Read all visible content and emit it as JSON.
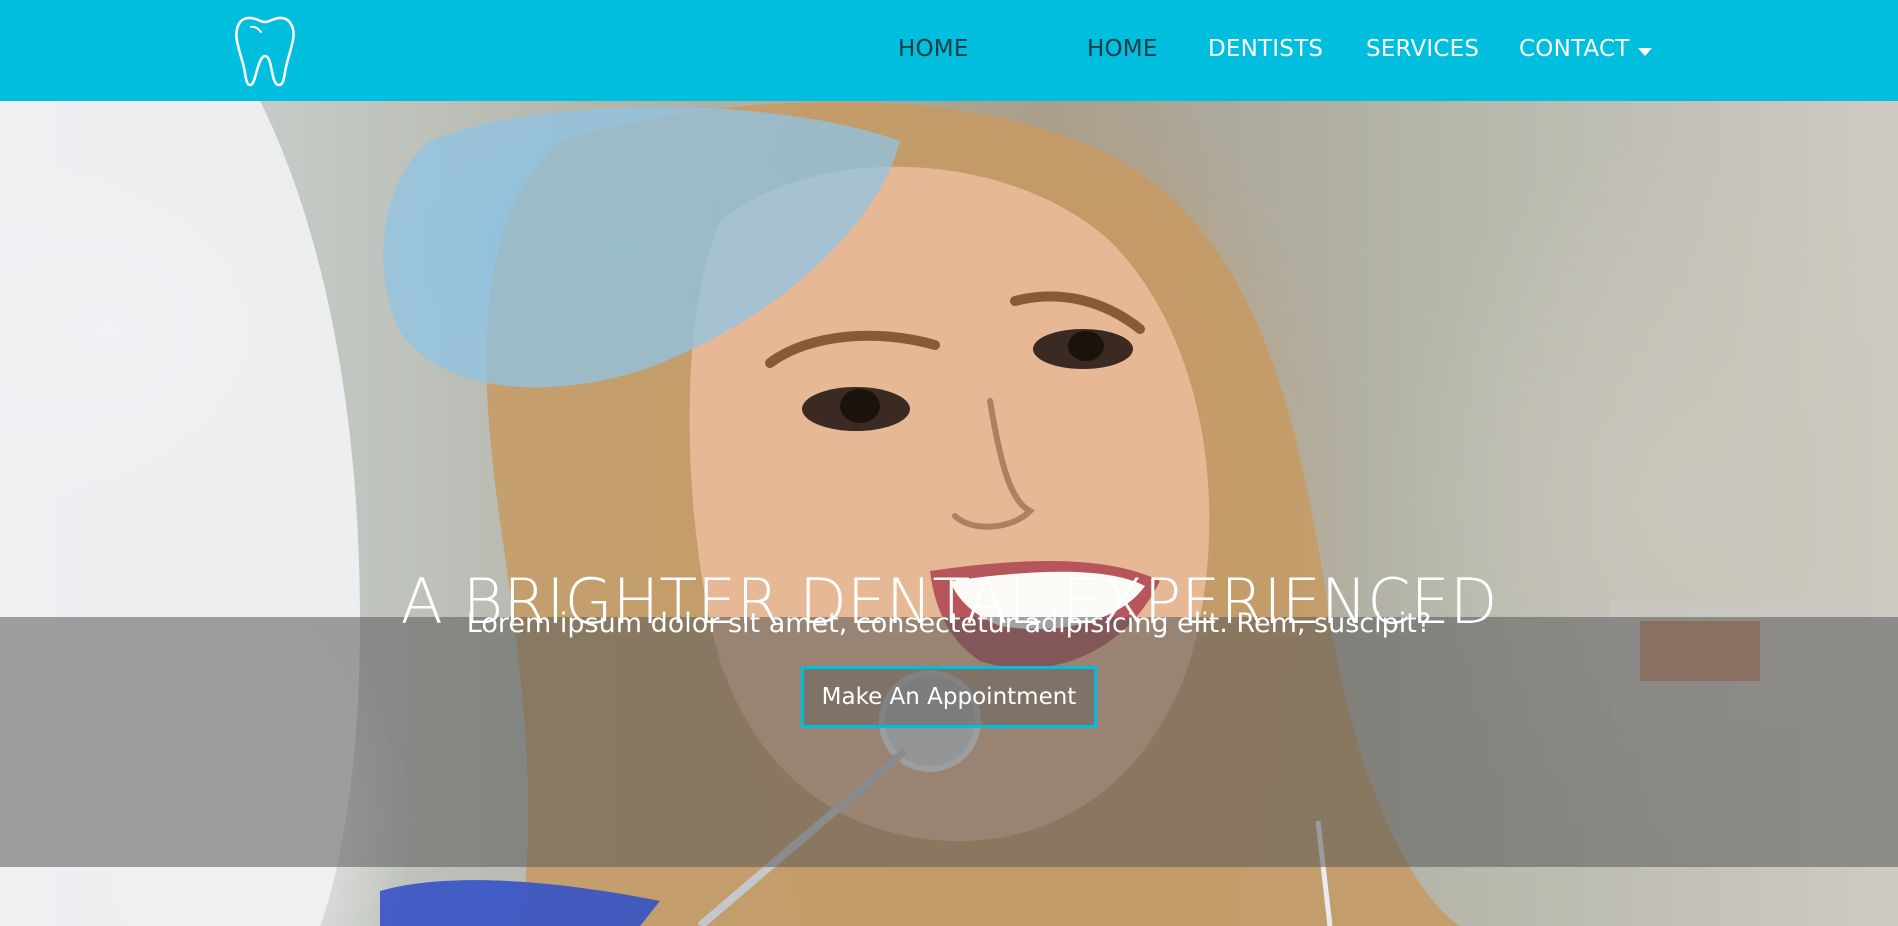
{
  "brand": {
    "logo_icon": "tooth-icon",
    "accent_color": "#00bedd",
    "active_nav_color": "#1d3a48"
  },
  "nav": {
    "items": [
      {
        "label": "HOME",
        "active": true
      },
      {
        "label": "DENTISTS",
        "active": false
      },
      {
        "label": "SERVICES",
        "active": false
      },
      {
        "label": "CONTACT",
        "active": false,
        "dropdown_icon": "caret-down-icon"
      }
    ]
  },
  "hero": {
    "title": "A BRIGHTER DENTAL EXPERIENCED",
    "subtitle": "Lorem ipsum dolor sit amet, consectetur adipisicing elit. Rem, suscipit?",
    "cta_label": "Make An Appointment"
  }
}
